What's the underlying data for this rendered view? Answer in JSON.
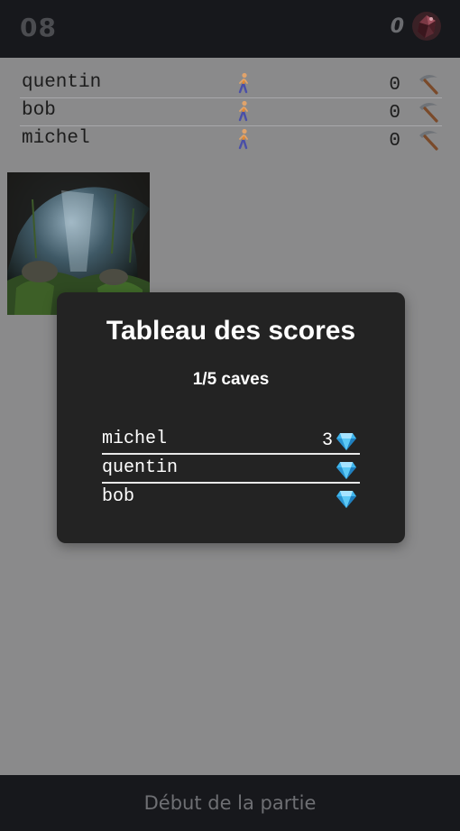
{
  "header": {
    "timer": "08",
    "gem_count": "0",
    "gem_icon": "red-gem-icon"
  },
  "players": [
    {
      "name": "quentin",
      "score": "0",
      "status_icon": "walking-person-icon",
      "tool_icon": "pickaxe-icon"
    },
    {
      "name": "bob",
      "score": "0",
      "status_icon": "walking-person-icon",
      "tool_icon": "pickaxe-icon"
    },
    {
      "name": "michel",
      "score": "0",
      "status_icon": "walking-person-icon",
      "tool_icon": "pickaxe-icon"
    }
  ],
  "cave": {
    "image_icon": "cave-image"
  },
  "scoreboard": {
    "title": "Tableau des scores",
    "subtitle": "1/5 caves",
    "rows": [
      {
        "name": "michel",
        "score": "3",
        "icon": "diamond-icon"
      },
      {
        "name": "quentin",
        "score": "",
        "icon": "diamond-icon"
      },
      {
        "name": "bob",
        "score": "",
        "icon": "diamond-icon"
      }
    ]
  },
  "footer": {
    "label": "Début de la partie"
  },
  "colors": {
    "overlay_background": "#8a8a8b",
    "bar_background": "#17181c",
    "modal_background": "#232323",
    "diamond": "#4fc3f7"
  }
}
